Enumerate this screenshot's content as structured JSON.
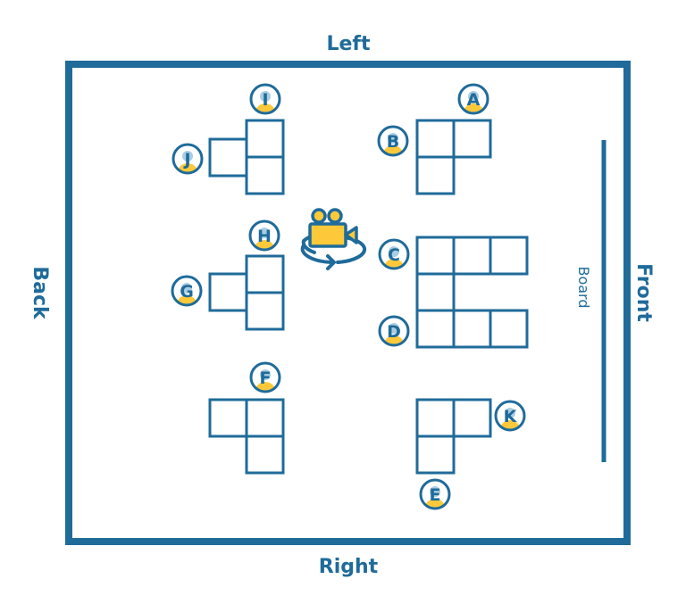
{
  "labels": {
    "left": "Left",
    "right": "Right",
    "back": "Back",
    "front": "Front",
    "board": "Board"
  },
  "colors": {
    "primary": "#1f6b9a",
    "accent": "#fdc93a",
    "head": "#a9cde3"
  },
  "icons": {
    "camera": "video-camera-rotate-icon",
    "person": "person-icon"
  },
  "seats": [
    "A",
    "B",
    "C",
    "D",
    "E",
    "F",
    "G",
    "H",
    "I",
    "J",
    "K"
  ]
}
